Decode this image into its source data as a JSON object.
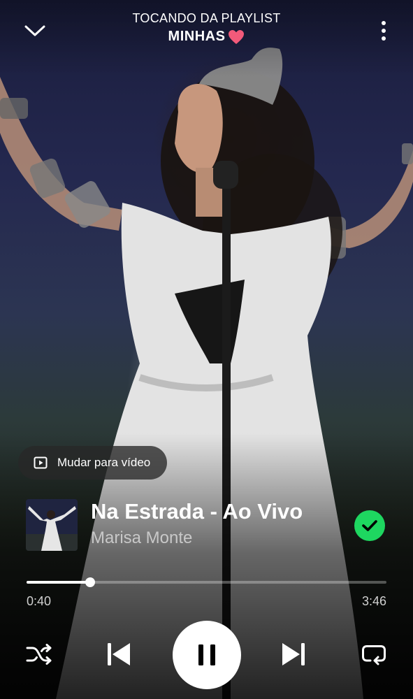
{
  "header": {
    "caption": "TOCANDO DA PLAYLIST",
    "playlist_name": "MINHAS",
    "playlist_emoji": "❤️",
    "collapse_icon": "chevron-down-icon",
    "menu_icon": "more-vertical-icon"
  },
  "video_switch": {
    "label": "Mudar para vídeo",
    "icon": "video-play-icon"
  },
  "track": {
    "title": "Na Estrada - Ao Vivo",
    "artist": "Marisa Monte",
    "liked": true,
    "liked_icon": "check-circle-icon",
    "accent_color": "#1ed760"
  },
  "playback": {
    "elapsed": "0:40",
    "total": "3:46",
    "progress_fraction": 0.177,
    "state": "playing"
  },
  "controls": {
    "shuffle_icon": "shuffle-icon",
    "previous_icon": "skip-previous-icon",
    "pause_icon": "pause-icon",
    "next_icon": "skip-next-icon",
    "repeat_icon": "repeat-icon"
  }
}
